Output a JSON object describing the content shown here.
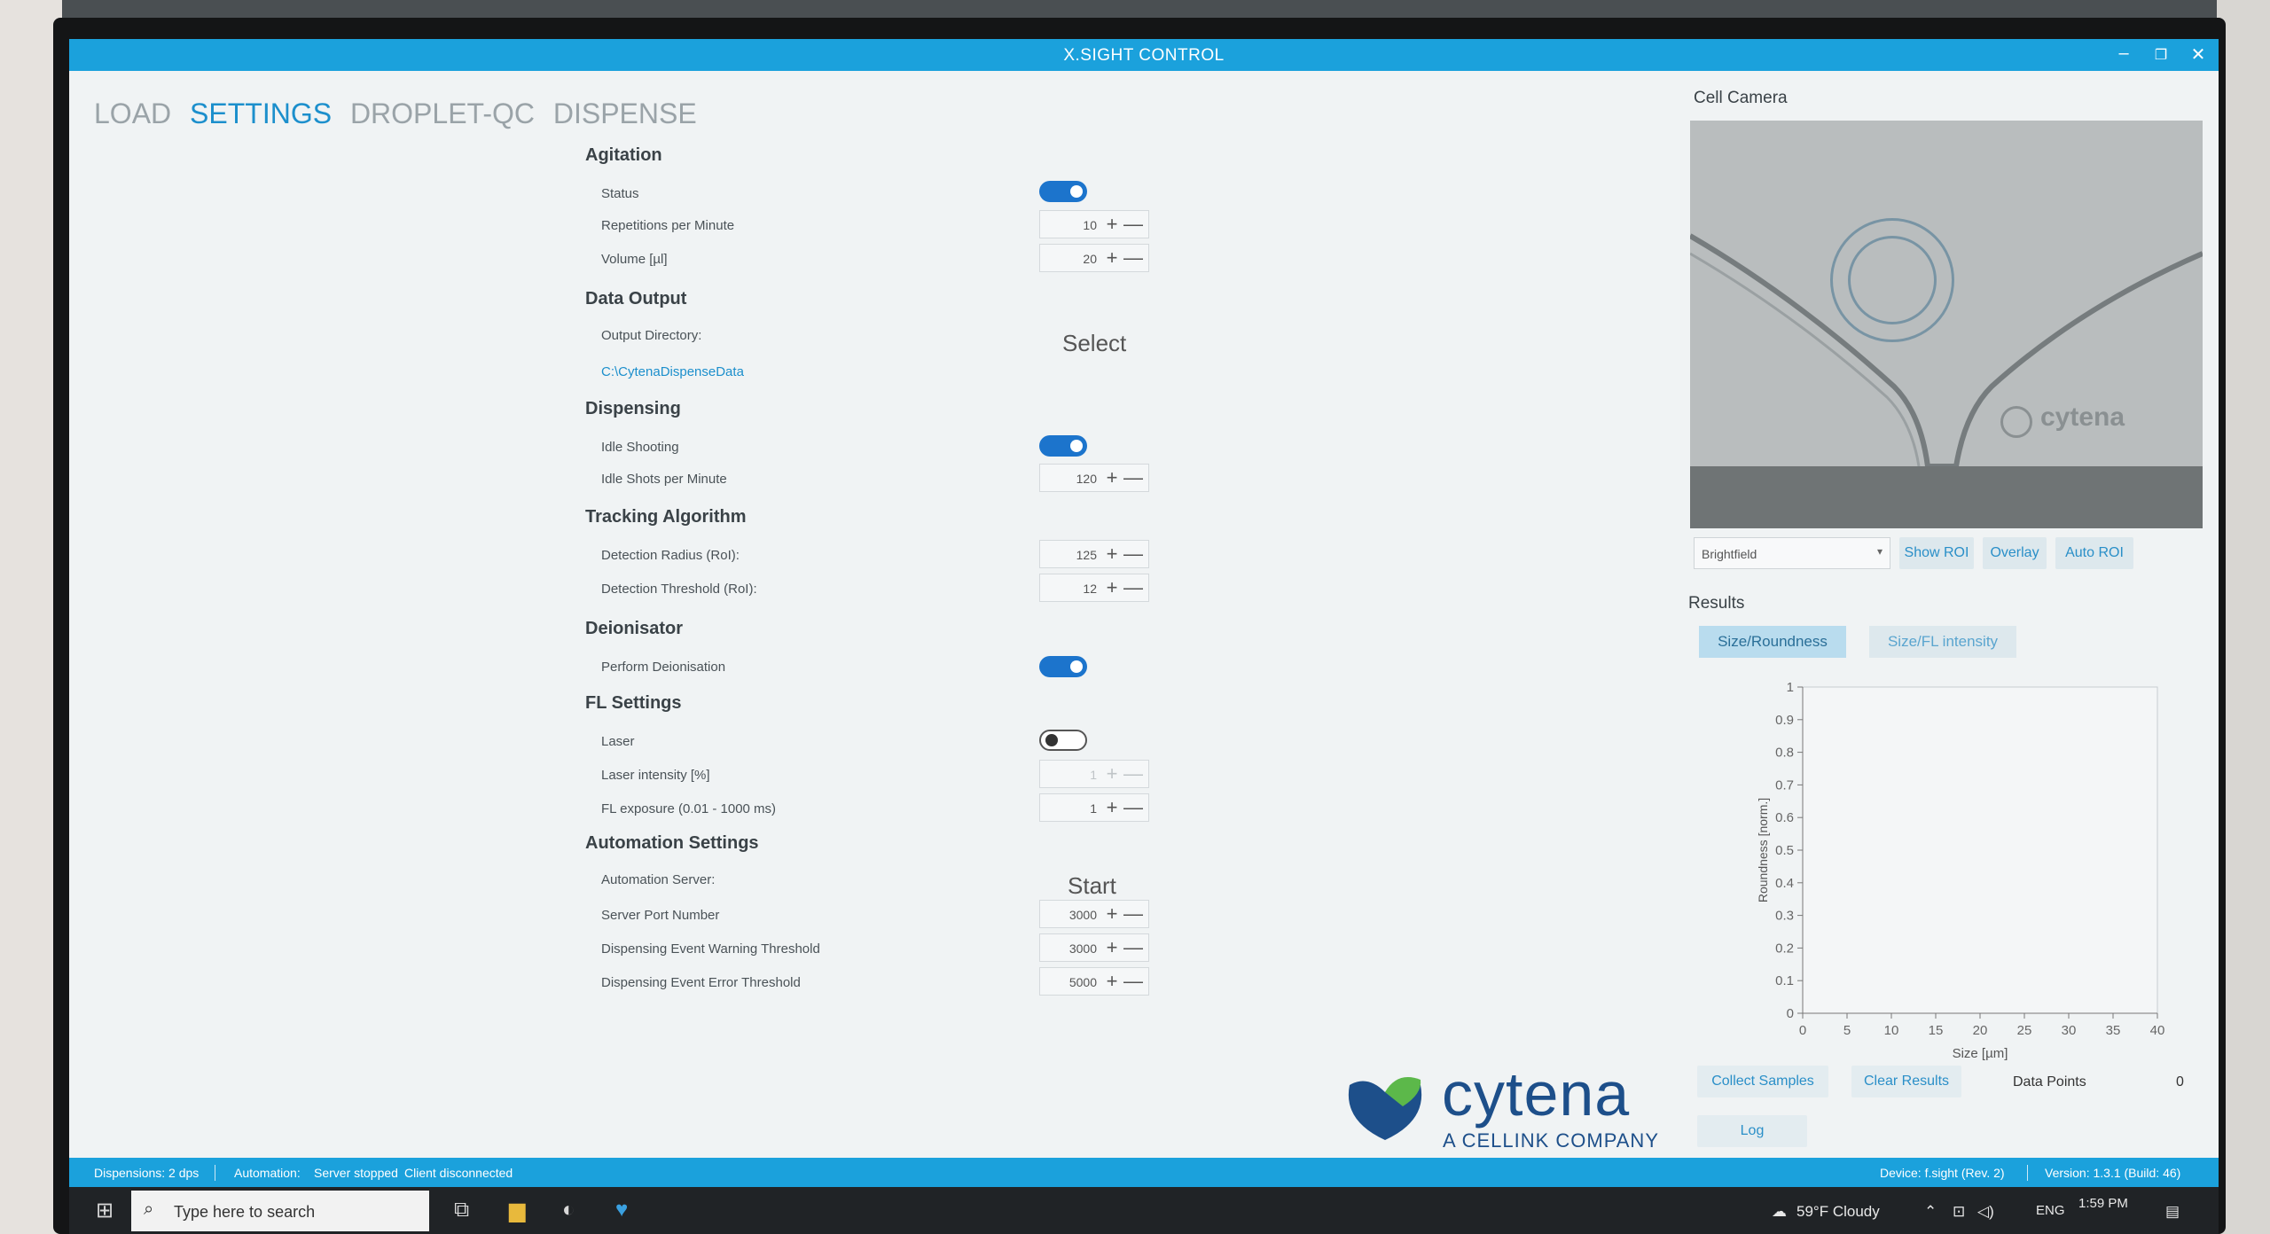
{
  "window": {
    "title": "X.SIGHT CONTROL"
  },
  "nav": {
    "tabs": [
      "LOAD",
      "SETTINGS",
      "DROPLET-QC",
      "DISPENSE"
    ],
    "active": "SETTINGS"
  },
  "settings": {
    "agitation": {
      "title": "Agitation",
      "status_label": "Status",
      "status_on": true,
      "rpm_label": "Repetitions per Minute",
      "rpm_value": "10",
      "volume_label": "Volume [µl]",
      "volume_value": "20"
    },
    "data_output": {
      "title": "Data Output",
      "dir_label": "Output Directory:",
      "select_label": "Select",
      "dir_path": "C:\\CytenaDispenseData"
    },
    "dispensing": {
      "title": "Dispensing",
      "idle_label": "Idle Shooting",
      "idle_on": true,
      "shots_label": "Idle Shots per Minute",
      "shots_value": "120"
    },
    "tracking": {
      "title": "Tracking Algorithm",
      "radius_label": "Detection Radius (RoI):",
      "radius_value": "125",
      "threshold_label": "Detection Threshold (RoI):",
      "threshold_value": "12"
    },
    "deionisator": {
      "title": "Deionisator",
      "perform_label": "Perform Deionisation",
      "perform_on": true
    },
    "fl": {
      "title": "FL Settings",
      "laser_label": "Laser",
      "laser_on": false,
      "intensity_label": "Laser intensity [%]",
      "intensity_value": "1",
      "exposure_label": "FL exposure (0.01 - 1000 ms)",
      "exposure_value": "1"
    },
    "automation": {
      "title": "Automation Settings",
      "server_label": "Automation Server:",
      "start_label": "Start",
      "port_label": "Server Port Number",
      "port_value": "3000",
      "warn_label": "Dispensing Event Warning Threshold",
      "warn_value": "3000",
      "error_label": "Dispensing Event Error Threshold",
      "error_value": "5000"
    },
    "stepper_symbols": {
      "plus": "+",
      "minus": "—"
    }
  },
  "camera": {
    "title": "Cell Camera",
    "overlay_text": "cytena",
    "mode": "Brightfield",
    "show_roi": "Show ROI",
    "overlay": "Overlay",
    "auto_roi": "Auto ROI"
  },
  "results": {
    "title": "Results",
    "tab_size_roundness": "Size/Roundness",
    "tab_size_fl": "Size/FL intensity",
    "collect": "Collect Samples",
    "clear": "Clear Results",
    "data_points_label": "Data Points",
    "data_points_value": "0",
    "log": "Log"
  },
  "chart_data": {
    "type": "scatter",
    "xlabel": "Size [µm]",
    "ylabel": "Roundness [norm.]",
    "xlim": [
      0,
      40
    ],
    "ylim": [
      0,
      1
    ],
    "x_ticks": [
      "0",
      "5",
      "10",
      "15",
      "20",
      "25",
      "30",
      "35",
      "40"
    ],
    "y_ticks": [
      "0",
      "0.1",
      "0.2",
      "0.3",
      "0.4",
      "0.5",
      "0.6",
      "0.7",
      "0.8",
      "0.9",
      "1"
    ],
    "points": []
  },
  "logo": {
    "name": "cytena",
    "tagline": "A CELLINK COMPANY"
  },
  "statusbar": {
    "dispensions": "Dispensions: 2 dps",
    "automation": "Automation:",
    "server_state": "Server stopped",
    "client_state": "Client disconnected",
    "device": "Device: f.sight (Rev. 2)",
    "version": "Version: 1.3.1 (Build: 46)"
  },
  "taskbar": {
    "search_placeholder": "Type here to search",
    "weather": "59°F Cloudy",
    "lang": "ENG",
    "time": "1:59 PM"
  },
  "colors": {
    "accent": "#1ba1dc",
    "toggle_on": "#1c74cc",
    "brand": "#1d4f8a"
  }
}
